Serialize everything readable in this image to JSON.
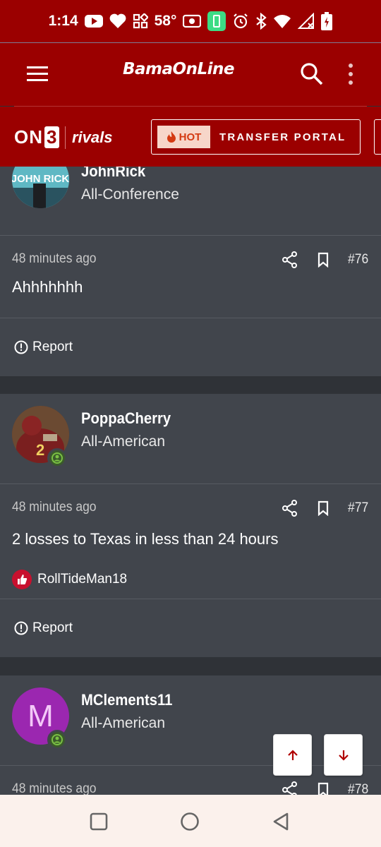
{
  "status_bar": {
    "time": "1:14",
    "temperature": "58°",
    "icons": [
      "youtube-icon",
      "heart-icon",
      "widgets-icon",
      "radio-icon",
      "battery-saver-icon",
      "alarm-icon",
      "bluetooth-icon",
      "wifi-icon",
      "signal-icon",
      "battery-icon"
    ]
  },
  "header": {
    "logo_text": "BamaOnLine",
    "menu_icon": "menu-icon",
    "search_icon": "search-icon",
    "more_icon": "more-vertical-icon"
  },
  "partner_bar": {
    "on3_text": "ON",
    "on3_number": "3",
    "rivals_text": "rivals",
    "hot_label": "HOT",
    "transfer_label": "TRANSFER PORTAL"
  },
  "posts": [
    {
      "username": "JohnRick",
      "rank": "All-Conference",
      "avatar_text": "JOHN RICK",
      "time": "48 minutes ago",
      "number": "#76",
      "body": "Ahhhhhhh",
      "report_label": "Report"
    },
    {
      "username": "PoppaCherry",
      "rank": "All-American",
      "time": "48 minutes ago",
      "number": "#77",
      "body": "2 losses to Texas in less than 24 hours",
      "reaction_user": "RollTideMan18",
      "report_label": "Report"
    },
    {
      "username": "MClements11",
      "rank": "All-American",
      "avatar_letter": "M",
      "time": "48 minutes ago",
      "number": "#78"
    }
  ],
  "colors": {
    "brand_red": "#9b0000",
    "card_bg": "#41454c",
    "page_bg": "#2f3237",
    "hot_bg": "#f7d6c9",
    "hot_text": "#d43a12",
    "online_green": "#7ac143",
    "avatar_purple": "#9b27b0"
  }
}
